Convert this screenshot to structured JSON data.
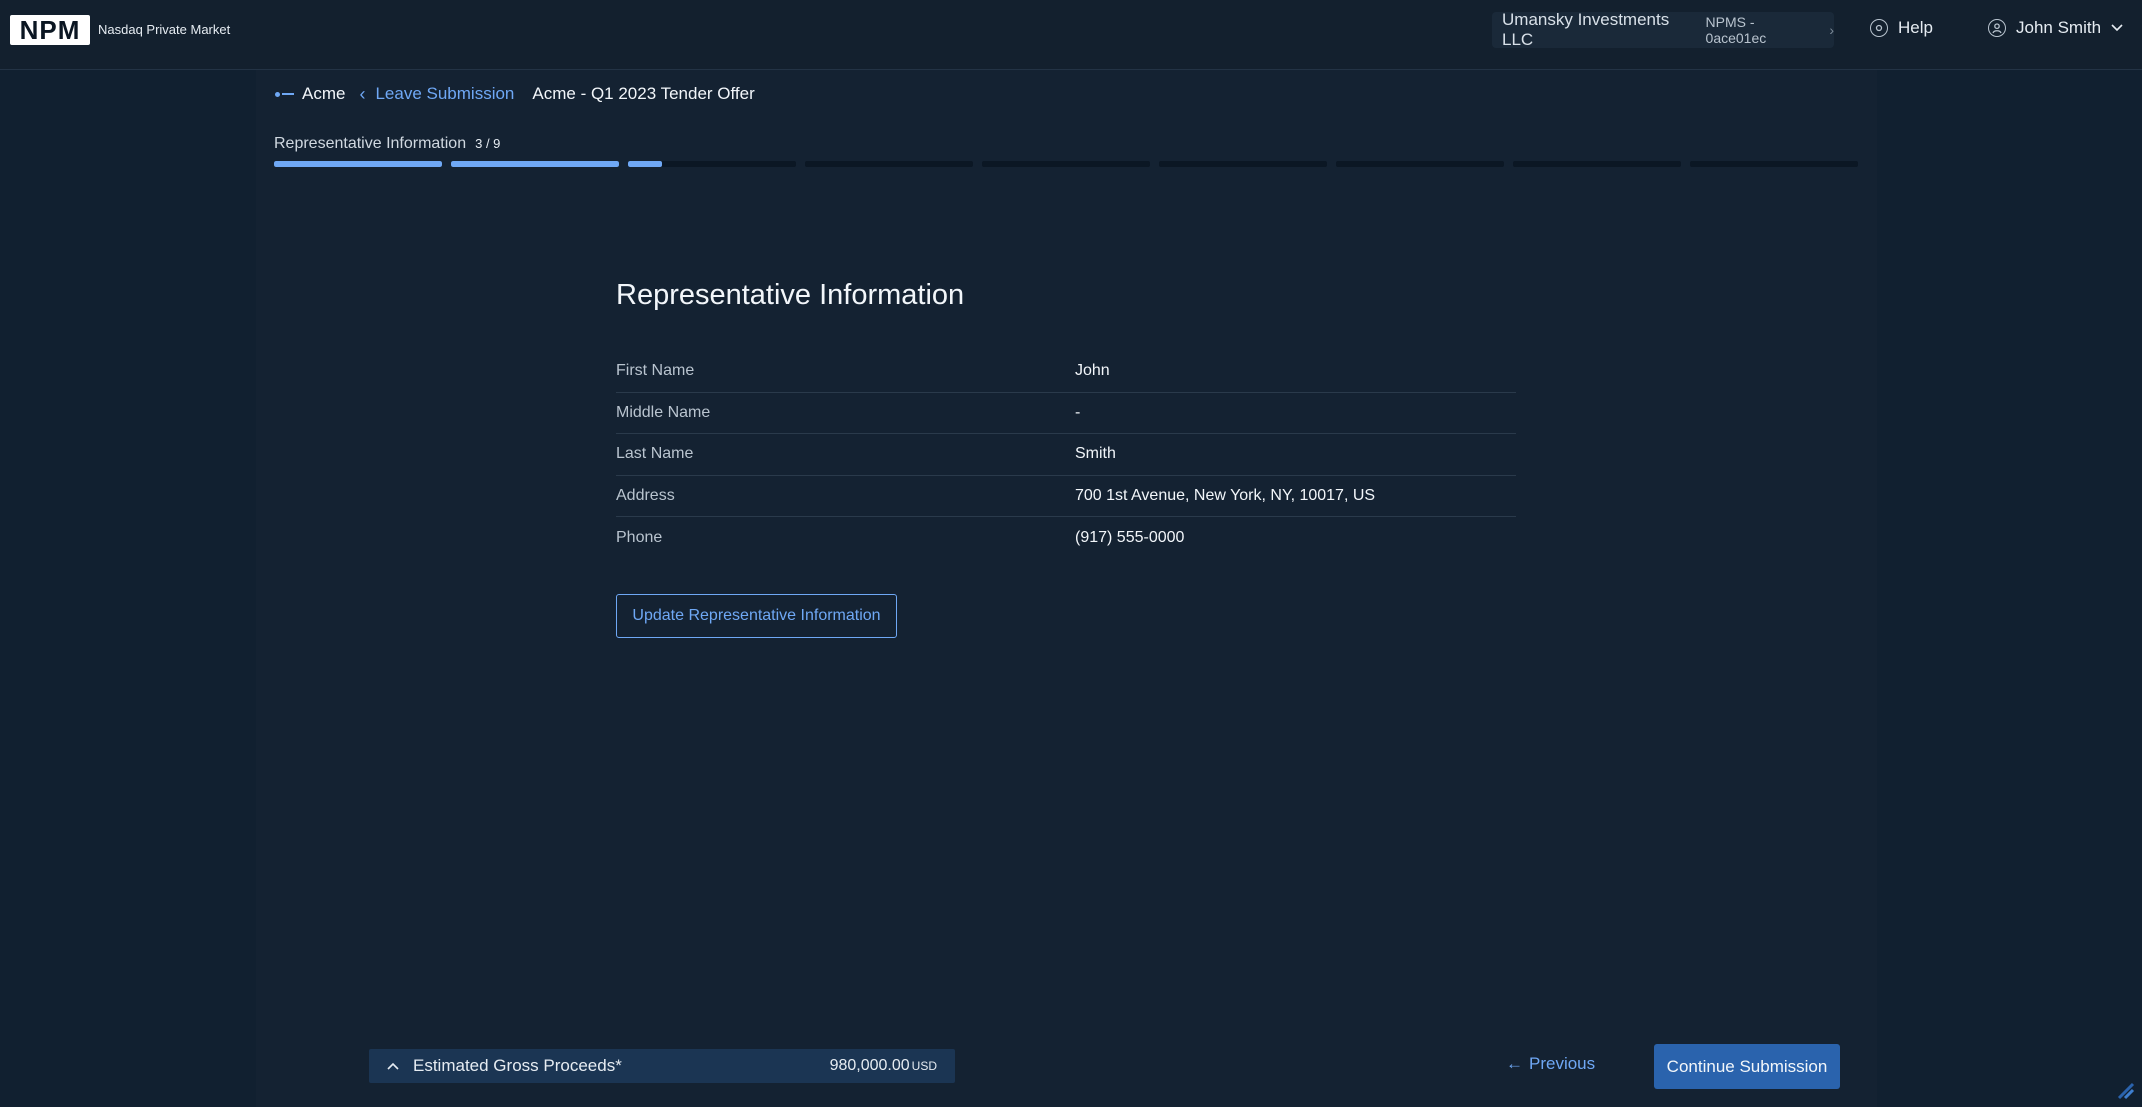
{
  "header": {
    "logo_text": "NPM",
    "logo_subtitle": "Nasdaq Private Market",
    "account_name": "Umansky Investments LLC",
    "account_id": "NPMS - 0ace01ec",
    "help_label": "Help",
    "user_name": "John Smith"
  },
  "breadcrumb": {
    "company": "Acme",
    "leave_label": "Leave Submission",
    "offer_name": "Acme - Q1 2023 Tender Offer"
  },
  "step": {
    "label": "Representative Information",
    "count": "3 / 9",
    "segments": [
      1,
      1,
      0.2,
      0,
      0,
      0,
      0,
      0,
      0
    ]
  },
  "section": {
    "title": "Representative Information",
    "fields": [
      {
        "label": "First Name",
        "value": "John"
      },
      {
        "label": "Middle Name",
        "value": "-"
      },
      {
        "label": "Last Name",
        "value": "Smith"
      },
      {
        "label": "Address",
        "value": "700 1st Avenue, New York, NY, 10017, US"
      },
      {
        "label": "Phone",
        "value": "(917) 555-0000"
      }
    ],
    "update_button": "Update Representative Information"
  },
  "footer": {
    "proceeds_label": "Estimated Gross Proceeds*",
    "proceeds_value": "980,000.00",
    "proceeds_unit": "USD",
    "previous_label": "Previous",
    "continue_label": "Continue Submission"
  },
  "colors": {
    "accent": "#6fa8f5",
    "primary_button": "#2a63ad",
    "background": "#142232"
  }
}
